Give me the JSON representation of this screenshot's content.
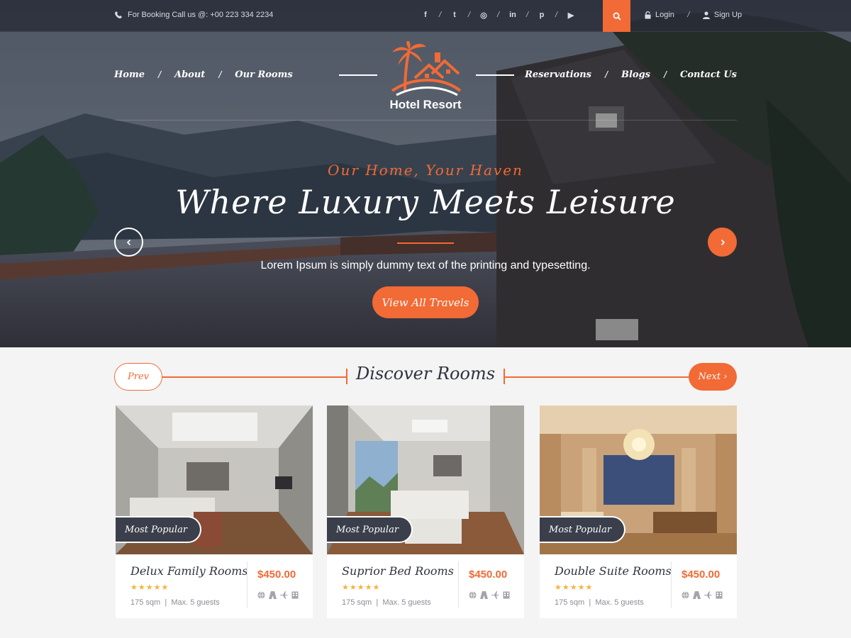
{
  "topbar": {
    "booking": "For Booking Call us @: +00 223 334 2234",
    "socials": [
      {
        "icon": "facebook-icon",
        "glyph": "f"
      },
      {
        "icon": "twitter-icon",
        "glyph": "t"
      },
      {
        "icon": "instagram-icon",
        "glyph": "◎"
      },
      {
        "icon": "linkedin-icon",
        "glyph": "in"
      },
      {
        "icon": "pinterest-icon",
        "glyph": "p"
      },
      {
        "icon": "youtube-icon",
        "glyph": "▶"
      }
    ],
    "login": "Login",
    "signup": "Sign Up"
  },
  "nav": {
    "left": [
      "Home",
      "About",
      "Our Rooms"
    ],
    "right": [
      "Reservations",
      "Blogs",
      "Contact Us"
    ]
  },
  "logo": {
    "name": "Hotel Resort"
  },
  "hero": {
    "eyebrow": "Our Home, Your Haven",
    "headline": "Where Luxury Meets Leisure",
    "subtext": "Lorem Ipsum is simply dummy text of the printing and typesetting.",
    "cta": "View All Travels"
  },
  "rooms": {
    "title": "Discover Rooms",
    "prev": "Prev",
    "next": "Next ›",
    "cards": [
      {
        "name": "Delux Family Rooms",
        "price": "$450.00",
        "badge": "Most Popular",
        "stars": "★★★★★",
        "area": "175 sqm",
        "sep": "|",
        "guests": "Max. 5 guests"
      },
      {
        "name": "Suprior Bed Rooms",
        "price": "$450.00",
        "badge": "Most Popular",
        "stars": "★★★★★",
        "area": "175 sqm",
        "sep": "|",
        "guests": "Max. 5 guests"
      },
      {
        "name": "Double Suite Rooms",
        "price": "$450.00",
        "badge": "Most Popular",
        "stars": "★★★★★",
        "area": "175 sqm",
        "sep": "|",
        "guests": "Max. 5 guests"
      }
    ]
  },
  "colors": {
    "accent": "#f26a35",
    "dark": "#3a3f4b",
    "star": "#f5b33a"
  }
}
